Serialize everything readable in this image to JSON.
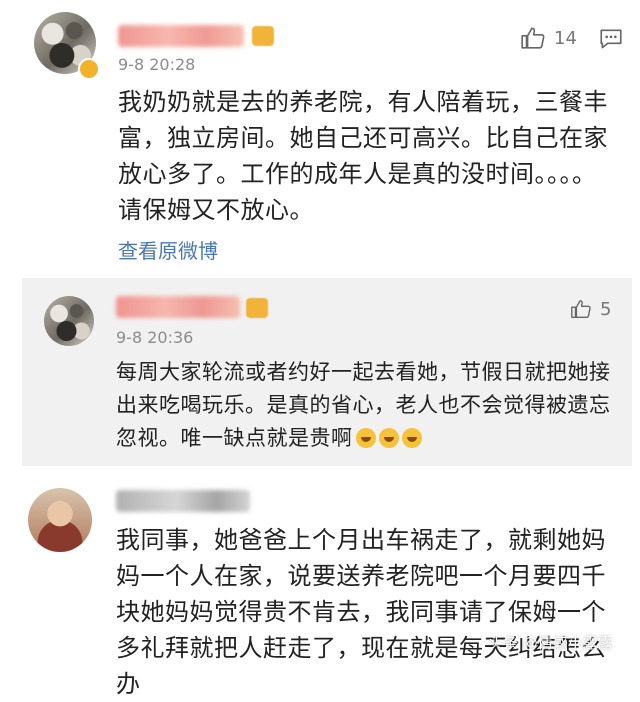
{
  "comment": {
    "time": "9-8 20:28",
    "text": "我奶奶就是去的养老院，有人陪着玩，三餐丰富，独立房间。她自己还可高兴。比自己在家放心多了。工作的成年人是真的没时间。。。。请保姆又不放心。",
    "like_count": "14",
    "view_original_label": "查看原微博"
  },
  "reply": {
    "time": "9-8 20:36",
    "text": "每周大家轮流或者约好一起去看她，节假日就把她接出来吃喝玩乐。是真的省心，老人也不会觉得被遗忘忽视。唯一缺点就是贵啊",
    "like_count": "5",
    "emoji_icon": "laugh-cry-emoji"
  },
  "comment2": {
    "text": "我同事，她爸爸上个月出车祸走了，就剩她妈妈一个人在家，说要送养老院吧一个月要四千块她妈妈觉得贵不肯去，我同事请了保姆一个多礼拜就把人赶走了，现在就是每天纠结怎么办"
  },
  "watermark": "头条 @情感小露露",
  "colors": {
    "link": "#4a77b3",
    "reply_background": "#f1f1f1",
    "vip_badge": "#f4b12a"
  }
}
